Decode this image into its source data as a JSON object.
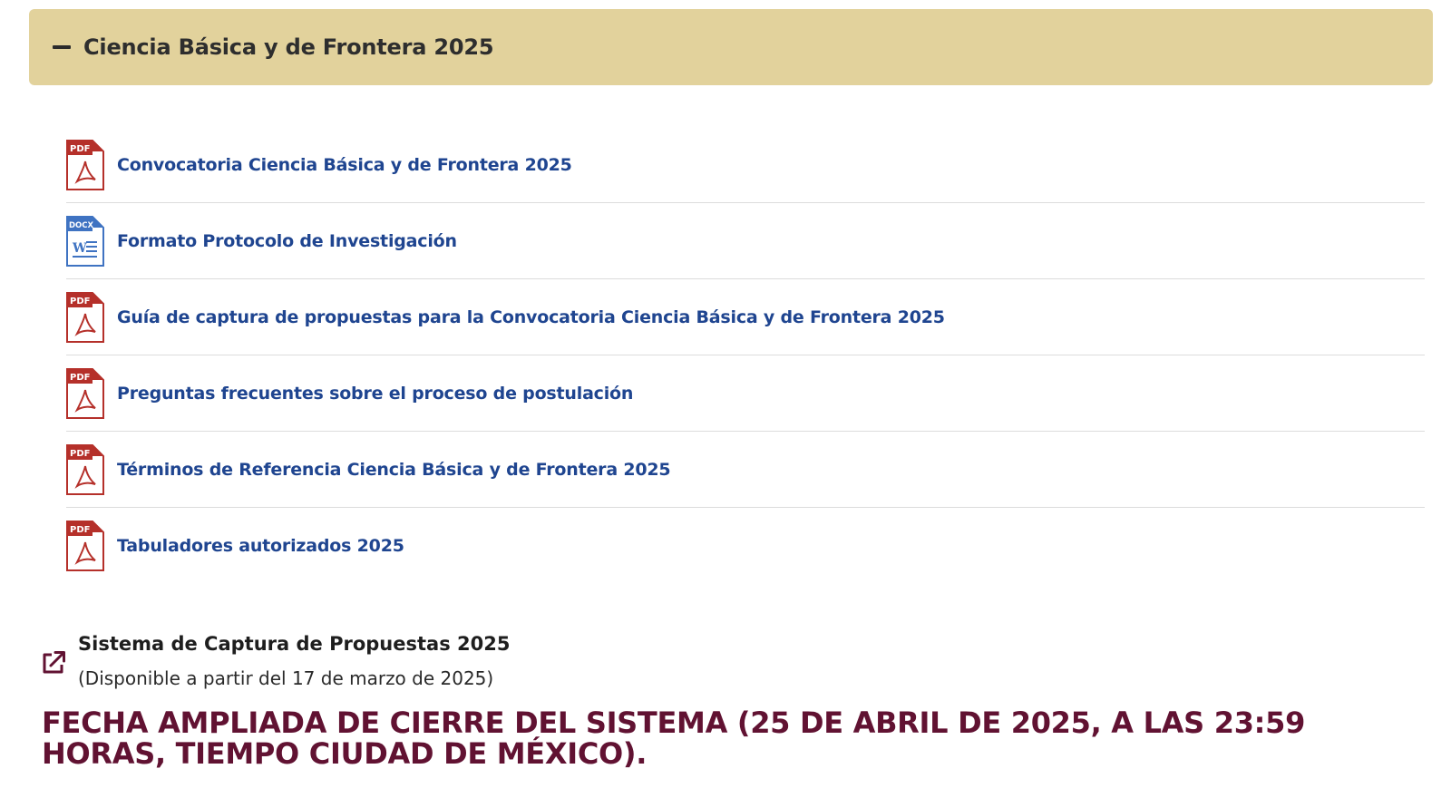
{
  "accordion": {
    "title": "Ciencia Básica y de Frontera 2025"
  },
  "documents": [
    {
      "label": "Convocatoria Ciencia Básica y de Frontera 2025",
      "type": "PDF"
    },
    {
      "label": "Formato Protocolo de Investigación",
      "type": "DOCX"
    },
    {
      "label": "Guía de captura de propuestas para la Convocatoria Ciencia Básica y de Frontera 2025",
      "type": "PDF"
    },
    {
      "label": "Preguntas frecuentes sobre el proceso de postulación",
      "type": "PDF"
    },
    {
      "label": "Términos de Referencia Ciencia Básica y de Frontera 2025",
      "type": "PDF"
    },
    {
      "label": "Tabuladores autorizados 2025",
      "type": "PDF"
    }
  ],
  "system": {
    "title": "Sistema de Captura de Propuestas 2025",
    "note": "(Disponible a partir del 17 de marzo de 2025)"
  },
  "deadline": "FECHA AMPLIADA DE CIERRE DEL SISTEMA (25 DE ABRIL DE 2025, A LAS 23:59 HORAS, TIEMPO CIUDAD DE MÉXICO).",
  "icons": {
    "collapse": "minus-icon",
    "pdf": "pdf-file-icon",
    "docx": "docx-file-icon",
    "external": "external-link-icon"
  },
  "colors": {
    "header_bg": "#e2d29c",
    "link": "#1f4590",
    "pdf": "#b5302a",
    "docx": "#3f73c2",
    "deadline": "#611232"
  }
}
